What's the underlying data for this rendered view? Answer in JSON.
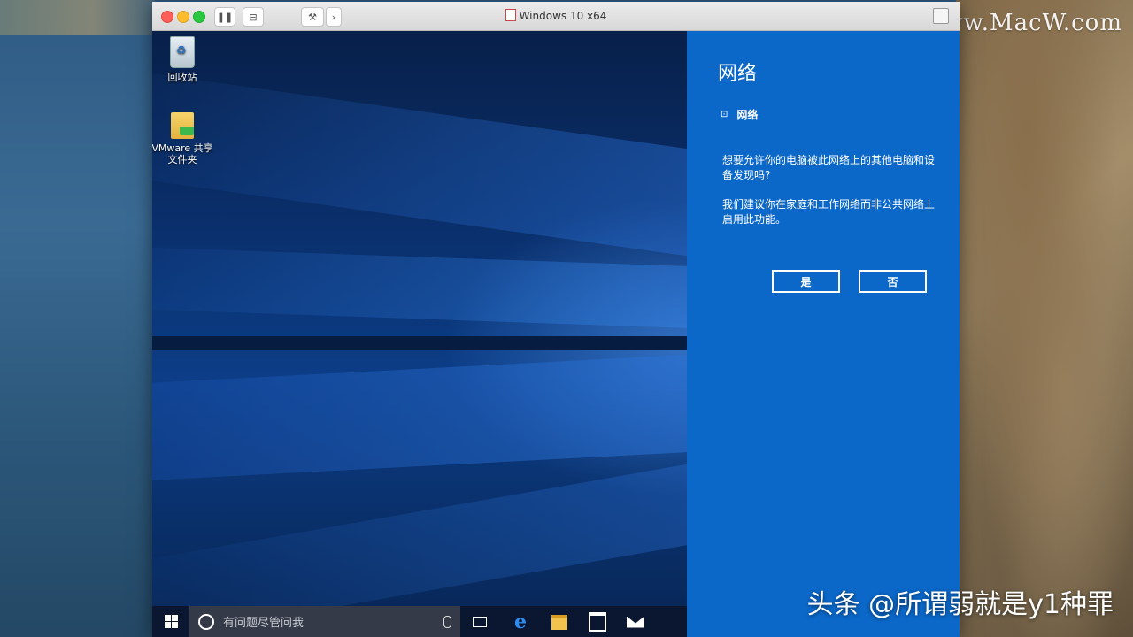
{
  "host": {
    "watermark": "www.MacW.com",
    "caption": "头条 @所谓弱就是y1种罪"
  },
  "vm_window": {
    "title": "Windows 10 x64",
    "toolbar": {
      "pause_icon": "pause-icon",
      "snapshot_icon": "snapshot-icon",
      "settings_icon": "wrench-icon",
      "forward_icon": "chevron-right-icon"
    }
  },
  "desktop": {
    "icons": [
      {
        "label": "回收站",
        "icon": "recycle-bin-icon"
      },
      {
        "label": "VMware 共享\n文件夹",
        "icon": "shared-folder-icon"
      }
    ]
  },
  "taskbar": {
    "search_placeholder": "有问题尽管问我",
    "apps": [
      "task-view-icon",
      "edge-icon",
      "file-explorer-icon",
      "store-icon",
      "mail-icon"
    ]
  },
  "network_flyout": {
    "title": "网络",
    "network_name": "网络",
    "question": "想要允许你的电脑被此网络上的其他电脑和设备发现吗?",
    "recommendation": "我们建议你在家庭和工作网络而非公共网络上启用此功能。",
    "yes_label": "是",
    "no_label": "否"
  }
}
